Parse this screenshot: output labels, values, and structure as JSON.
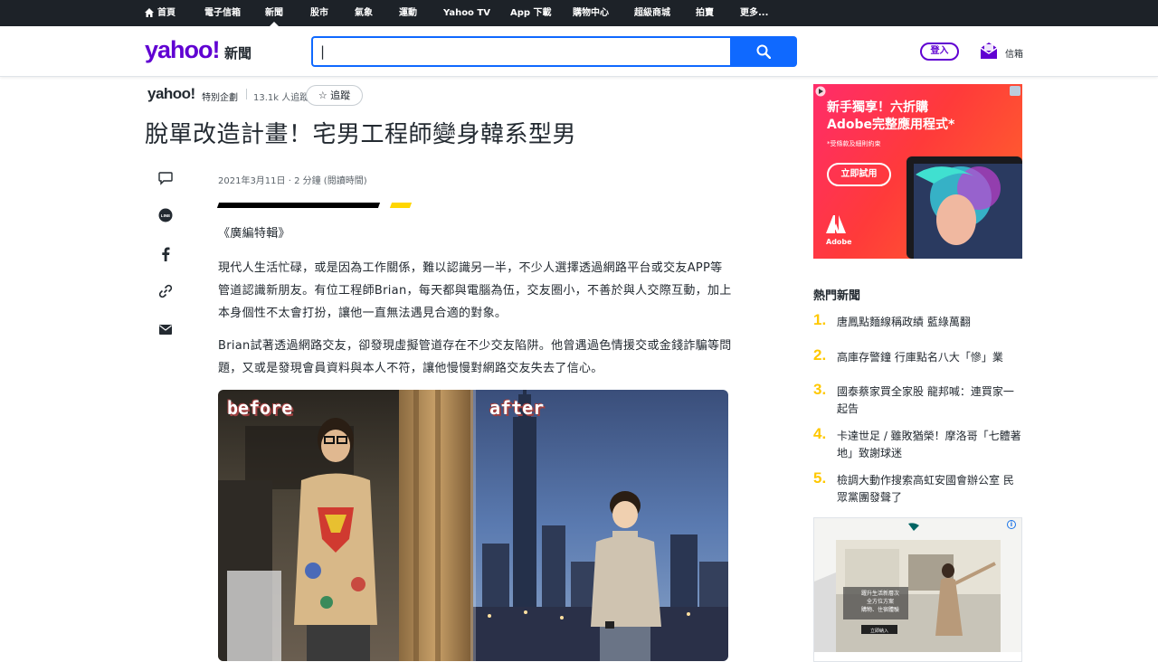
{
  "topnav": {
    "items": [
      "首頁",
      "電子信箱",
      "新聞",
      "股市",
      "氣象",
      "運動",
      "Yahoo TV",
      "App 下載",
      "購物中心",
      "超級商城",
      "拍賣",
      "更多..."
    ]
  },
  "header": {
    "logo": "yahoo!",
    "logo_sub": "新聞",
    "search_value": "|",
    "login_label": "登入",
    "mail_label": "信箱"
  },
  "provider": {
    "logo": "yahoo!",
    "sub": "特別企劃",
    "count": "13.1k 人追蹤",
    "follow_label": "☆ 追蹤"
  },
  "article": {
    "title": "脫單改造計畫！宅男工程師變身韓系型男",
    "meta": "2021年3月11日 · 2 分鐘 (閱讀時間)",
    "paragraphs": [
      "《廣編特輯》",
      "現代人生活忙碌，或是因為工作關係，難以認識另一半，不少人選擇透過網路平台或交友APP等管道認識新朋友。有位工程師Brian，每天都與電腦為伍，交友圈小，不善於與人交際互動，加上本身個性不太會打扮，讓他一直無法遇見合適的對象。",
      "Brian試著透過網路交友，卻發現虛擬管道存在不少交友陷阱。他曾遇過色情援交或金錢詐騙等問題，又或是發現會員資料與本人不符，讓他慢慢對網路交友失去了信心。"
    ],
    "photo": {
      "before_label": "before",
      "after_label": "after"
    }
  },
  "ad_top": {
    "headline_1": "新手獨享！六折購",
    "headline_2": "Adobe完整應用程式*",
    "small": "*受條款及細則約束",
    "cta": "立即試用",
    "brand": "Adobe"
  },
  "trending": {
    "title": "熱門新聞",
    "items": [
      {
        "num": "1.",
        "text": "唐鳳點麵線稱政績 藍綠萬翻"
      },
      {
        "num": "2.",
        "text": "高庫存警鐘 行庫點名八大「慘」業"
      },
      {
        "num": "3.",
        "text": "國泰蔡家買全家股 龍邦喊：連買家一起告"
      },
      {
        "num": "4.",
        "text": "卡達世足 / 雖敗猶榮！摩洛哥「七體著地」致謝球迷"
      },
      {
        "num": "5.",
        "text": "檢調大動作搜索高虹安國會辦公室 民眾黨團發聲了"
      }
    ]
  },
  "ad_bottom": {
    "line1": "躍升生活新層次",
    "line2": "全方位方案",
    "line3": "購物、住宿體驗",
    "cta": "立即納入"
  },
  "colors": {
    "brand_purple": "#6001d2",
    "search_blue": "#0f69ff",
    "nav_bg": "#1d2228",
    "trend_yellow": "#ffc800"
  }
}
